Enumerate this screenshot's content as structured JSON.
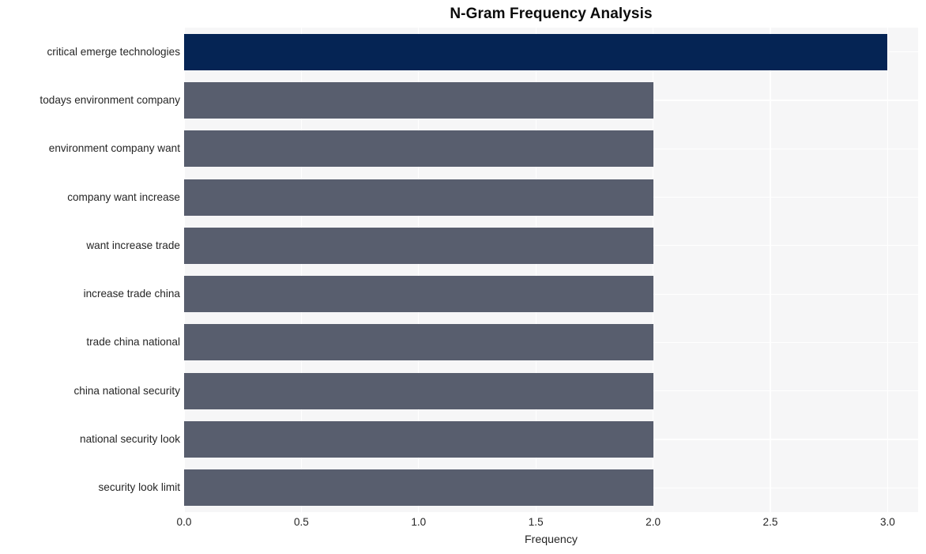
{
  "chart_data": {
    "type": "bar",
    "orientation": "horizontal",
    "title": "N-Gram Frequency Analysis",
    "xlabel": "Frequency",
    "ylabel": "",
    "categories": [
      "critical emerge technologies",
      "todays environment company",
      "environment company want",
      "company want increase",
      "want increase trade",
      "increase trade china",
      "trade china national",
      "china national security",
      "national security look",
      "security look limit"
    ],
    "values": [
      3,
      2,
      2,
      2,
      2,
      2,
      2,
      2,
      2,
      2
    ],
    "xlim": [
      0,
      3.13
    ],
    "xticks": [
      "0.0",
      "0.5",
      "1.0",
      "1.5",
      "2.0",
      "2.5",
      "3.0"
    ],
    "xtick_values": [
      0.0,
      0.5,
      1.0,
      1.5,
      2.0,
      2.5,
      3.0
    ],
    "grid": true,
    "legend": null,
    "bar_colors": [
      "#052454",
      "#585e6e",
      "#585e6e",
      "#585e6e",
      "#585e6e",
      "#585e6e",
      "#585e6e",
      "#585e6e",
      "#585e6e",
      "#585e6e"
    ],
    "style": {
      "plot_background": "#f6f6f7",
      "figure_background": "#ffffff",
      "gridline_color": "#ffffff",
      "text_color": "#262626",
      "title_color": "#0b0b0b"
    }
  }
}
